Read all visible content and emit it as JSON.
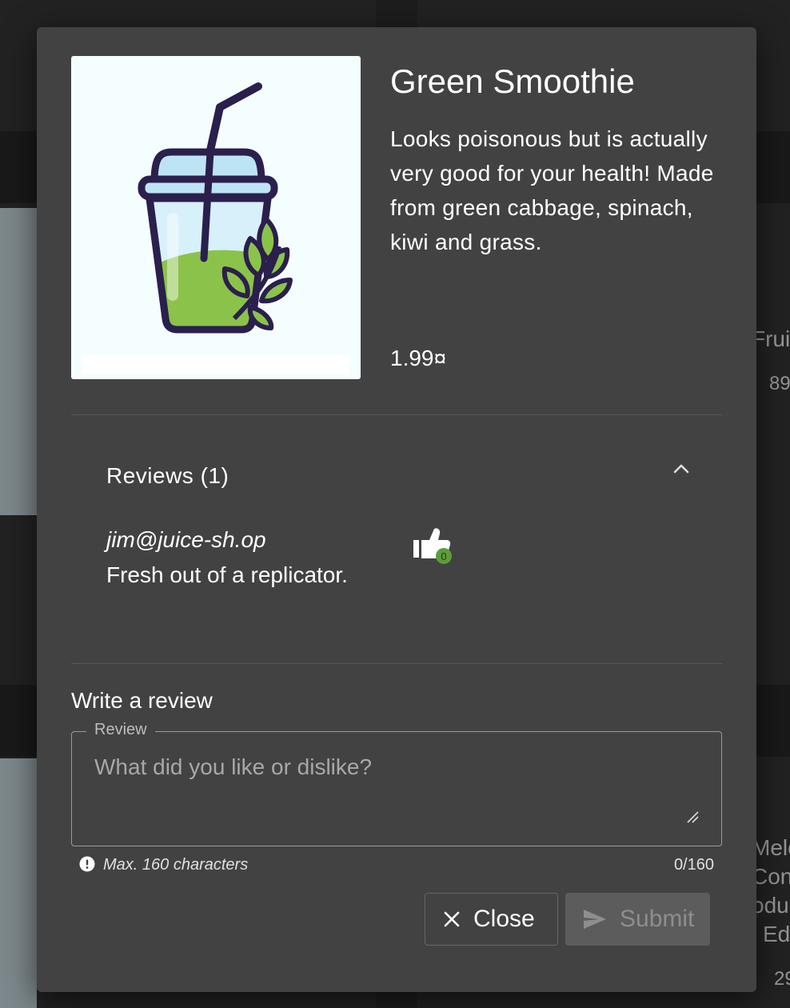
{
  "background": {
    "card_right_1_title": "Frui",
    "card_right_1_price": "89",
    "card_right_2_lines": [
      "Melo",
      "Con",
      "odu",
      "Ed"
    ],
    "card_right_2_price": "29"
  },
  "product": {
    "name": "Green Smoothie",
    "description": "Looks poisonous but is actually very good for your health! Made from green cabbage, spinach, kiwi and grass.",
    "price": "1.99¤",
    "image_icon": "green-smoothie-cup-icon"
  },
  "reviews": {
    "header": "Reviews (1)",
    "items": [
      {
        "author": "jim@juice-sh.op",
        "text": "Fresh out of a replicator.",
        "likes": "0"
      }
    ]
  },
  "write_review": {
    "heading": "Write a review",
    "field_label": "Review",
    "placeholder": "What did you like or dislike?",
    "hint": "Max. 160 characters",
    "counter": "0/160"
  },
  "buttons": {
    "close_label": "Close",
    "submit_label": "Submit"
  },
  "colors": {
    "dialog_bg": "#424242",
    "like_badge": "#5d9c3a",
    "smoothie_green": "#8bc34a",
    "cup_outline": "#2b1f4d"
  }
}
